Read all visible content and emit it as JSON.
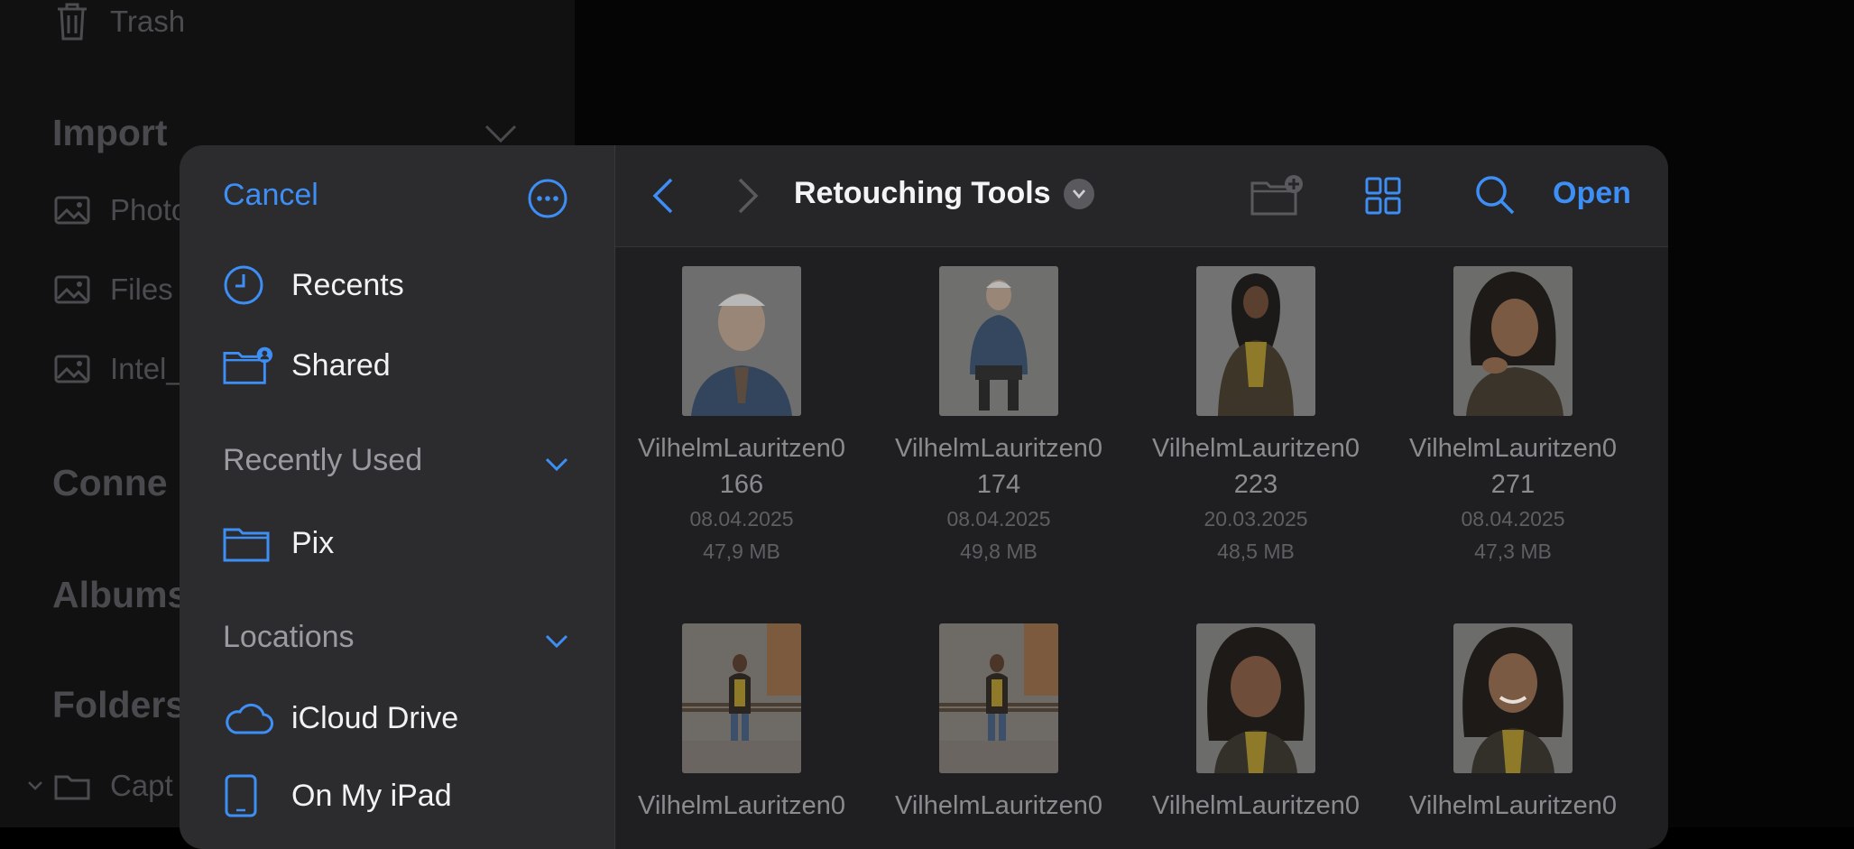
{
  "background": {
    "sidebar_items": [
      {
        "label": "Trash",
        "icon": "trash-icon"
      },
      {
        "label": "Photo",
        "icon": "photo-icon"
      },
      {
        "label": "Files",
        "icon": "photo-icon"
      },
      {
        "label": "Intel_",
        "icon": "photo-icon"
      },
      {
        "label": "Capt",
        "icon": "folder-icon"
      }
    ],
    "headings": [
      "Import",
      "Conne",
      "Albums",
      "Folders"
    ]
  },
  "dialog": {
    "cancel_label": "Cancel",
    "sidebar": {
      "top_items": [
        {
          "label": "Recents",
          "icon": "clock-icon"
        },
        {
          "label": "Shared",
          "icon": "shared-folder-icon"
        }
      ],
      "recently_used": {
        "heading": "Recently Used",
        "items": [
          {
            "label": "Pix",
            "icon": "folder-icon"
          }
        ]
      },
      "locations": {
        "heading": "Locations",
        "items": [
          {
            "label": "iCloud Drive",
            "icon": "cloud-icon"
          },
          {
            "label": "On My iPad",
            "icon": "ipad-icon"
          }
        ]
      }
    },
    "toolbar": {
      "title": "Retouching Tools",
      "open_label": "Open"
    },
    "files": [
      {
        "name1": "VilhelmLauritzen0",
        "name2": "166",
        "date": "08.04.2025",
        "size": "47,9 MB"
      },
      {
        "name1": "VilhelmLauritzen0",
        "name2": "174",
        "date": "08.04.2025",
        "size": "49,8 MB"
      },
      {
        "name1": "VilhelmLauritzen0",
        "name2": "223",
        "date": "20.03.2025",
        "size": "48,5 MB"
      },
      {
        "name1": "VilhelmLauritzen0",
        "name2": "271",
        "date": "08.04.2025",
        "size": "47,3 MB"
      },
      {
        "name1": "VilhelmLauritzen0"
      },
      {
        "name1": "VilhelmLauritzen0"
      },
      {
        "name1": "VilhelmLauritzen0"
      },
      {
        "name1": "VilhelmLauritzen0"
      }
    ],
    "colors": {
      "accent": "#3d8ef5",
      "dialog_bg": "#1f1f21",
      "sidebar_bg": "#2c2c2e"
    }
  }
}
